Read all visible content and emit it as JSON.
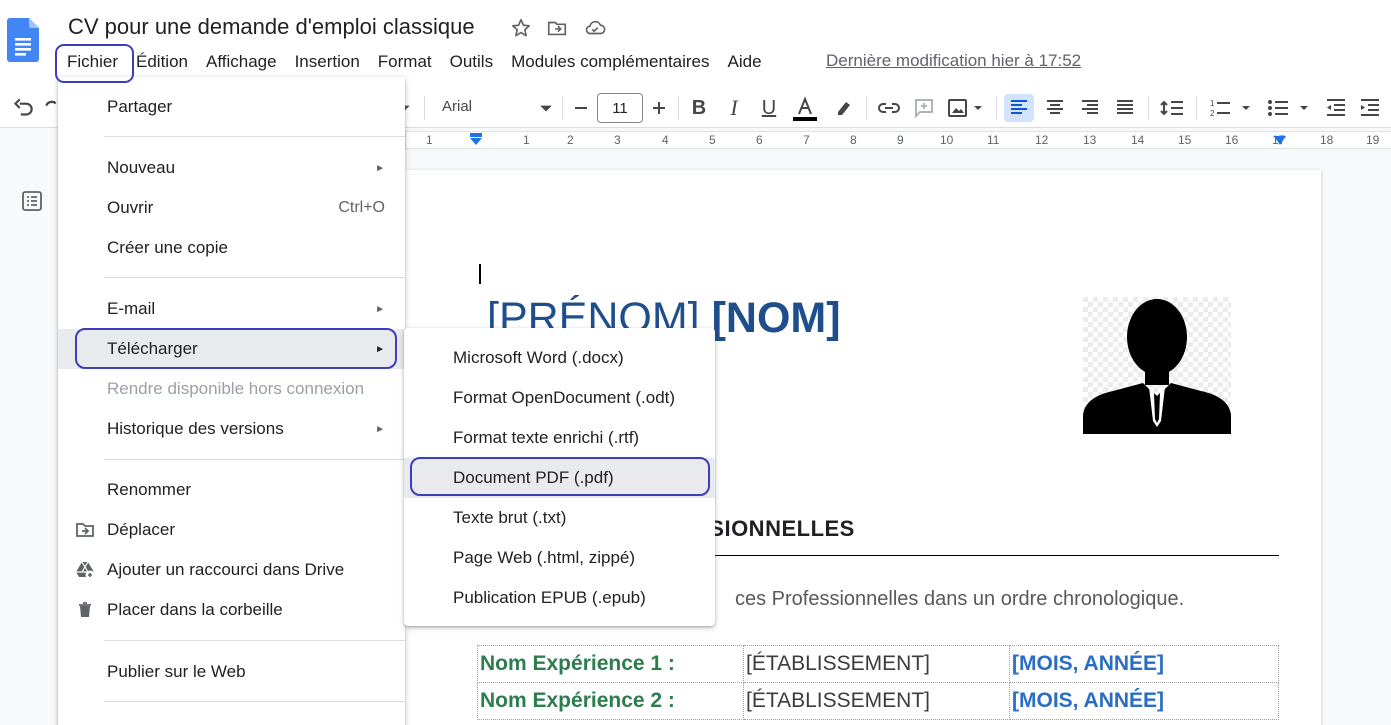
{
  "app": {
    "title": "CV pour une demande d'emploi classique",
    "last_edit": "Dernière modification hier à 17:52"
  },
  "menubar": [
    "Fichier",
    "Édition",
    "Affichage",
    "Insertion",
    "Format",
    "Outils",
    "Modules complémentaires",
    "Aide"
  ],
  "toolbar": {
    "font": "Arial",
    "font_size": "11"
  },
  "ruler": [
    "1",
    "1",
    "2",
    "3",
    "4",
    "5",
    "6",
    "7",
    "8",
    "9",
    "10",
    "11",
    "12",
    "13",
    "14",
    "15",
    "16",
    "17",
    "18",
    "19"
  ],
  "file_menu": {
    "items": [
      {
        "label": "Partager"
      },
      {
        "label": "Nouveau",
        "submenu": true
      },
      {
        "label": "Ouvrir",
        "shortcut": "Ctrl+O"
      },
      {
        "label": "Créer une copie"
      },
      {
        "label": "E-mail",
        "submenu": true
      },
      {
        "label": "Télécharger",
        "submenu": true,
        "highlighted": true
      },
      {
        "label": "Rendre disponible hors connexion",
        "disabled": true
      },
      {
        "label": "Historique des versions",
        "submenu": true
      },
      {
        "label": "Renommer"
      },
      {
        "label": "Déplacer",
        "icon": "move-folder-icon"
      },
      {
        "label": "Ajouter un raccourci dans Drive",
        "icon": "drive-shortcut-icon"
      },
      {
        "label": "Placer dans la corbeille",
        "icon": "trash-icon"
      },
      {
        "label": "Publier sur le Web"
      }
    ]
  },
  "download_menu": {
    "items": [
      {
        "label": "Microsoft Word (.docx)"
      },
      {
        "label": "Format OpenDocument (.odt)"
      },
      {
        "label": "Format texte enrichi (.rtf)"
      },
      {
        "label": "Document PDF (.pdf)",
        "highlighted": true
      },
      {
        "label": "Texte brut (.txt)"
      },
      {
        "label": "Page Web (.html, zippé)"
      },
      {
        "label": "Publication EPUB (.epub)"
      }
    ]
  },
  "document": {
    "first_name": "[PRÉNOM]",
    "last_name": "[NOM]",
    "section_title": "FESSIONNELLES",
    "intro": "ces Professionnelles dans un ordre chronologique.",
    "experiences": [
      {
        "name": "Nom Expérience 1 :",
        "establishment": "[ÉTABLISSEMENT]",
        "date": "[MOIS, ANNÉE]"
      },
      {
        "name": "Nom Expérience 2 :",
        "establishment": "[ÉTABLISSEMENT]",
        "date": "[MOIS, ANNÉE]"
      }
    ]
  },
  "colors": {
    "accent_blue": "#1a73e8",
    "name_blue": "#1f4e8c",
    "annotation_oval": "#3d3fb8",
    "exp_green": "#2e7d4f",
    "date_blue": "#2a6ec4"
  }
}
